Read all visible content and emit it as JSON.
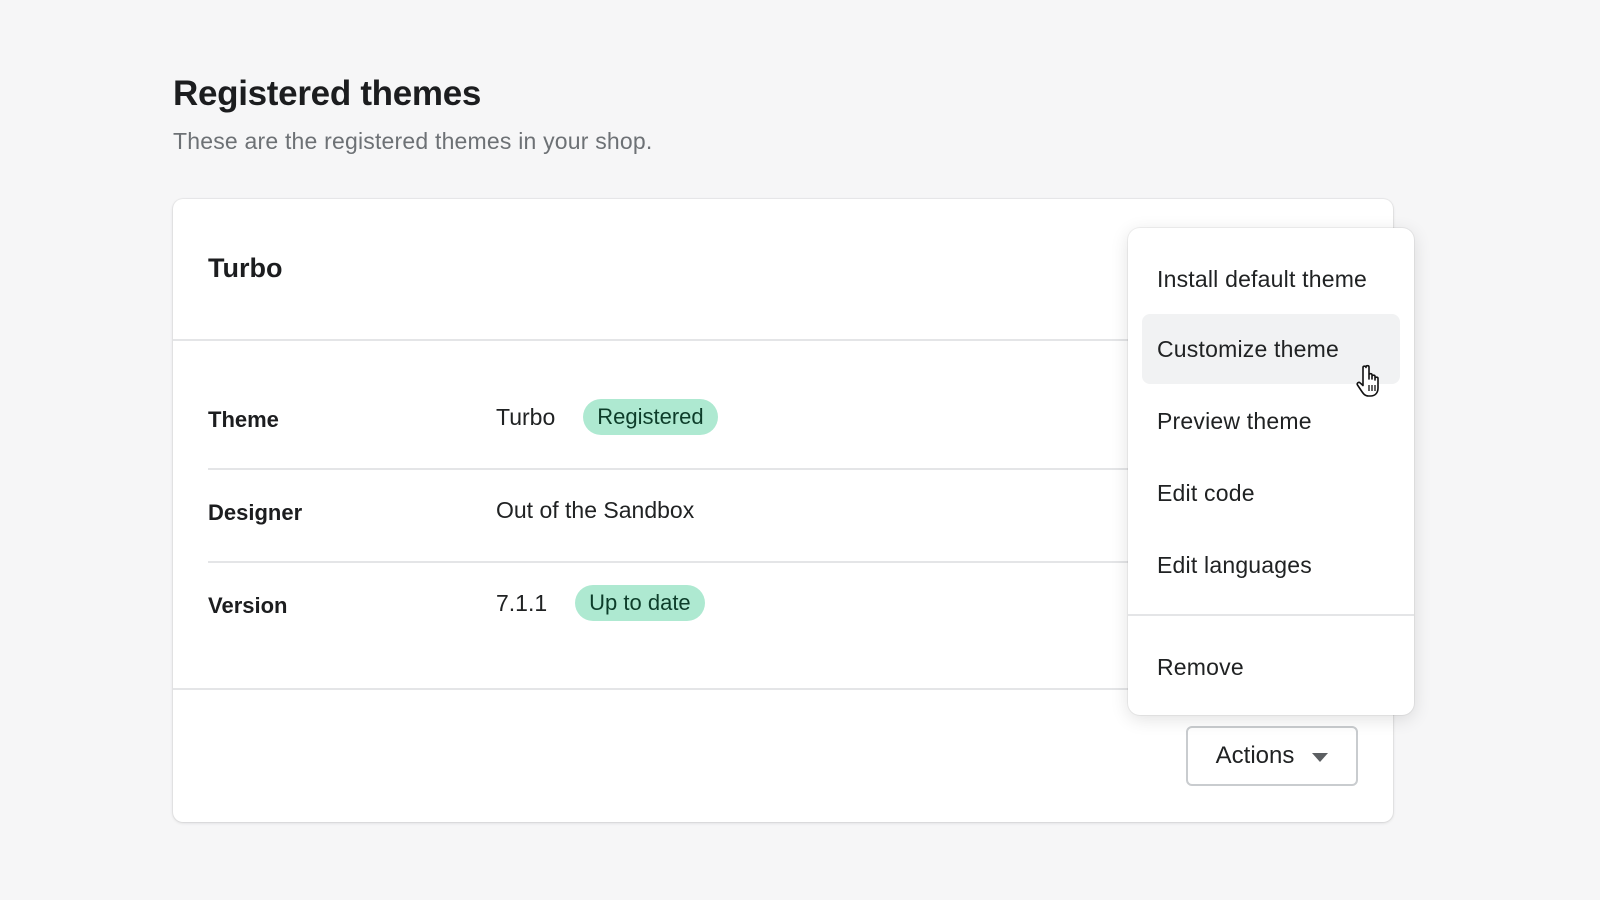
{
  "page": {
    "title": "Registered themes",
    "subtitle": "These are the registered themes in your shop."
  },
  "card": {
    "title": "Turbo",
    "rows": [
      {
        "label": "Theme",
        "value": "Turbo",
        "badge": "Registered"
      },
      {
        "label": "Designer",
        "value": "Out of the Sandbox",
        "badge": ""
      },
      {
        "label": "Version",
        "value": "7.1.1",
        "badge": "Up to date"
      }
    ],
    "actions_label": "Actions"
  },
  "menu": {
    "items": [
      {
        "label": "Install default theme"
      },
      {
        "label": "Customize theme",
        "state": "hovered"
      },
      {
        "label": "Preview theme"
      },
      {
        "label": "Edit code"
      },
      {
        "label": "Edit languages"
      },
      {
        "label": "Remove"
      }
    ]
  },
  "colors": {
    "background": "#f6f6f7",
    "badge_green": "#aee9d1",
    "menu_hover": "#f1f2f3"
  },
  "icons": {
    "actions_caret": "caret-down-icon",
    "cursor": "pointer-hand-icon"
  }
}
